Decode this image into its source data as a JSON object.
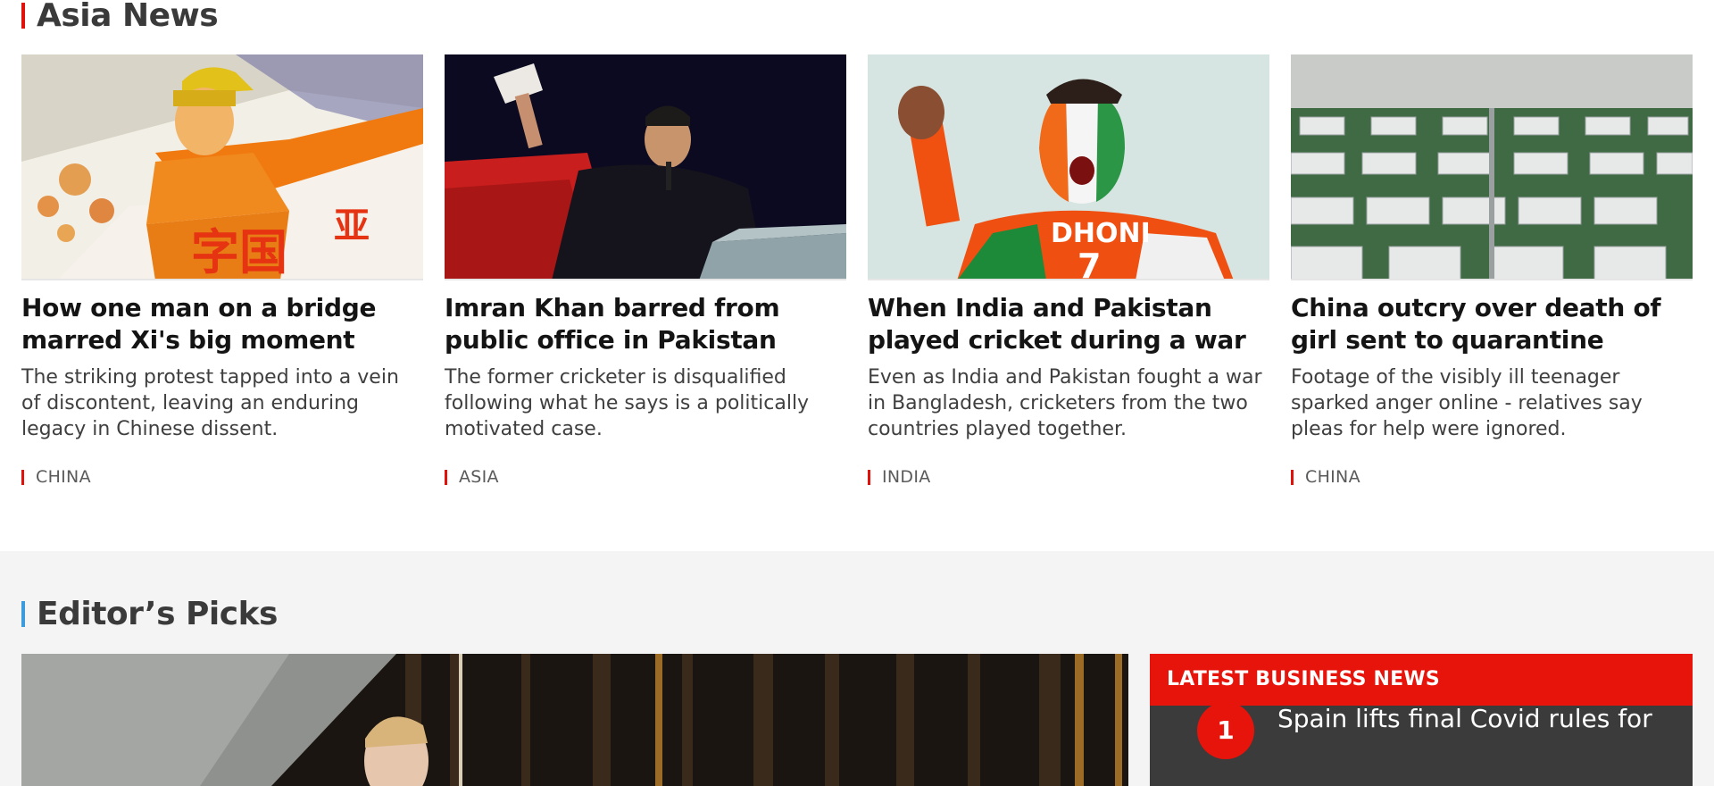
{
  "asia_news": {
    "title": "Asia News",
    "cards": [
      {
        "headline": "How one man on a bridge marred Xi's big moment",
        "summary": "The striking protest tapped into a vein of discontent, leaving an enduring legacy in Chinese dissent.",
        "tag": "CHINA",
        "image": "propaganda-poster-image"
      },
      {
        "headline": "Imran Khan barred from public office in Pakistan",
        "summary": "The former cricketer is disqualified following what he says is a politically motivated case.",
        "tag": "ASIA",
        "image": "imran-khan-speech-image"
      },
      {
        "headline": "When India and Pakistan played cricket during a war",
        "summary": "Even as India and Pakistan fought a war in Bangladesh, cricketers from the two countries played together.",
        "tag": "INDIA",
        "image": "cricket-fan-image"
      },
      {
        "headline": "China outcry over death of girl sent to quarantine",
        "summary": "Footage of the visibly ill teenager sparked anger online - relatives say pleas for help were ignored.",
        "tag": "CHINA",
        "image": "quarantine-beds-image"
      }
    ]
  },
  "editors_picks": {
    "title": "Editor’s Picks",
    "hero_image": "runner-image"
  },
  "latest_business": {
    "header": "LATEST BUSINESS NEWS",
    "items": [
      {
        "number": "1",
        "title": "Spain lifts final Covid rules for"
      }
    ]
  },
  "colors": {
    "accent_red": "#e0120b",
    "editors_blue": "#3b9bdc",
    "panel_dark": "#3b3b3b",
    "panel_header_red": "#e7140c"
  }
}
